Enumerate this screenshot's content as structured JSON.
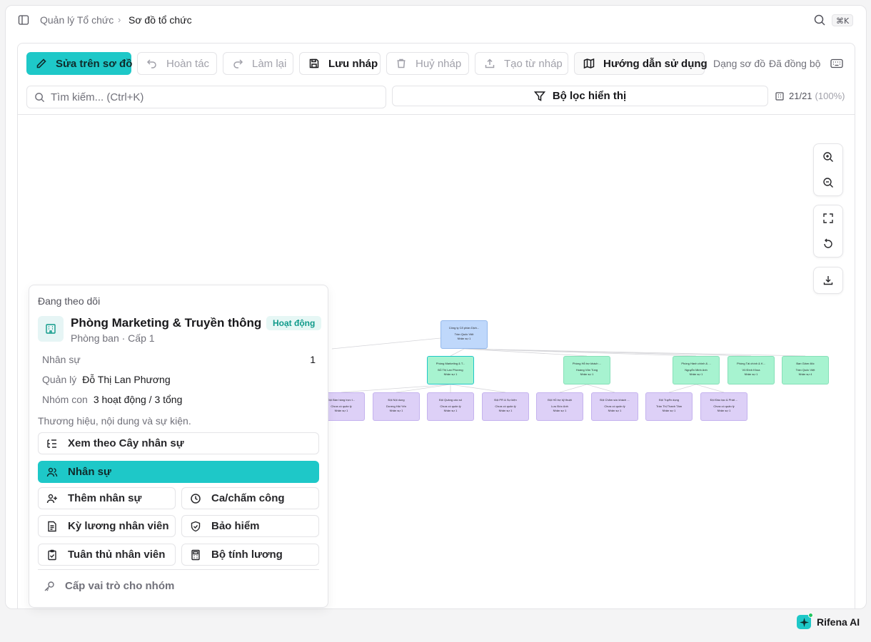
{
  "breadcrumb": {
    "parent": "Quản lý Tổ chức",
    "current": "Sơ đồ tổ chức",
    "separator": "›"
  },
  "shortcut": "⌘K",
  "toolbar": {
    "edit": "Sửa trên sơ đồ",
    "undo": "Hoàn tác",
    "redo": "Làm lại",
    "save_draft": "Lưu nháp",
    "discard_draft": "Huỷ nháp",
    "from_draft": "Tạo từ nháp",
    "guide": "Hướng dẫn sử dụng",
    "view_mode": "Dạng sơ đồ",
    "sync_status": "Đã đồng bộ"
  },
  "search": {
    "placeholder": "Tìm kiếm... (Ctrl+K)",
    "value": ""
  },
  "filter_label": "Bộ lọc hiển thị",
  "count": {
    "value": "21/21",
    "percent": "(100%)"
  },
  "zoom_controls": [
    "zoom-in",
    "zoom-out",
    "fit-view",
    "reset",
    "download"
  ],
  "org_chart": {
    "root": {
      "title": "Công ty Cổ phần Dịch...",
      "manager": "Trần Quốc Việt",
      "count": "Nhân sự 1"
    },
    "departments": [
      {
        "title": "Phòng Marketing & T...",
        "manager": "Đỗ Thị Lan Phương",
        "count": "Nhân sự 1",
        "selected": true
      },
      {
        "title": "Phòng Hỗ trợ khách ...",
        "manager": "Hoàng Văn Tùng",
        "count": "Nhân sự 1"
      },
      {
        "title": "Phòng Hành chính & ...",
        "manager": "Nguyễn Minh Anh",
        "count": "Nhân sự 1"
      },
      {
        "title": "Phòng Tài chính & K...",
        "manager": "Vũ Đình Khoa",
        "count": "Nhân sự 1"
      },
      {
        "title": "Ban Giám đốc",
        "manager": "Trần Quốc Việt",
        "count": "Nhân sự 4"
      }
    ],
    "teams": [
      {
        "title": "Đội Bán hàng trực t...",
        "manager": "Chưa có quản lý",
        "count": "Nhân sự 1"
      },
      {
        "title": "Đội Nội dung",
        "manager": "Dương Hải Yến",
        "count": "Nhân sự 1"
      },
      {
        "title": "Đội Quảng cáo số",
        "manager": "Chưa có quản lý",
        "count": "Nhân sự 1"
      },
      {
        "title": "Đội PR & Sự kiện",
        "manager": "Chưa có quản lý",
        "count": "Nhân sự 1"
      },
      {
        "title": "Đội Hỗ trợ kỹ thuật",
        "manager": "Lưu Đức Anh",
        "count": "Nhân sự 1"
      },
      {
        "title": "Đội Chăm sóc khách ...",
        "manager": "Chưa có quản lý",
        "count": "Nhân sự 1"
      },
      {
        "title": "Đội Tuyển dụng",
        "manager": "Trần Thị Thanh Tâm",
        "count": "Nhân sự 1"
      },
      {
        "title": "Đội Đào tạo & Phát ...",
        "manager": "Chưa có quản lý",
        "count": "Nhân sự 1"
      }
    ]
  },
  "info_card": {
    "heading": "Đang theo dõi",
    "title": "Phòng Marketing & Truyền thông",
    "subtitle": "Phòng ban · Cấp 1",
    "status": "Hoạt động",
    "headcount_label": "Nhân sự",
    "headcount_value": "1",
    "manager_label": "Quản lý",
    "manager_value": "Đỗ Thị Lan Phương",
    "subgroups_label": "Nhóm con",
    "subgroups_value": "3 hoạt động / 3 tổng",
    "description": "Thương hiệu, nội dung và sự kiện.",
    "actions": {
      "tree_view": "Xem theo Cây nhân sự",
      "staff": "Nhân sự",
      "add_staff": "Thêm nhân sự",
      "shifts": "Ca/chấm công",
      "payroll_period": "Kỳ lương nhân viên",
      "insurance": "Bảo hiểm",
      "compliance": "Tuân thủ nhân viên",
      "salary_calc": "Bộ tính lương",
      "assign_role": "Cấp vai trò cho nhóm"
    }
  },
  "assistant": "Rifena AI",
  "colors": {
    "accent": "#1ec8c8",
    "root_node": "#bfd8fb",
    "dept_node": "#a7f3d0",
    "team_node": "#ddd0f7"
  }
}
